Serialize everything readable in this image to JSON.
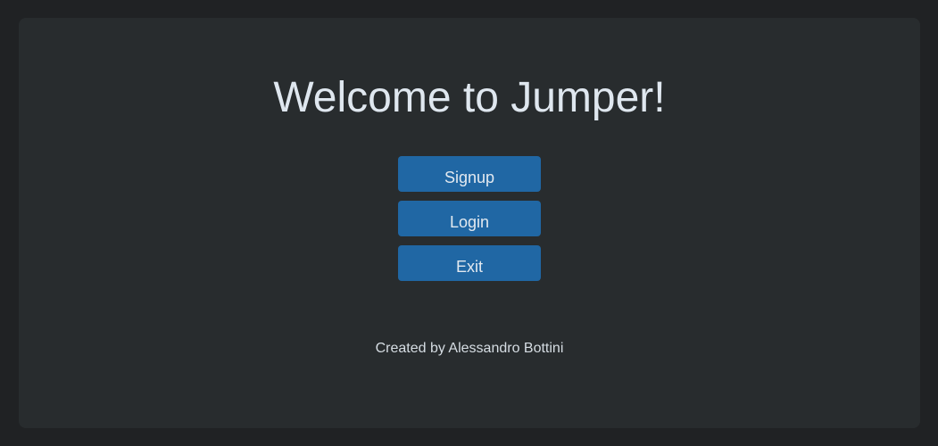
{
  "page": {
    "title": "Welcome to Jumper!",
    "credit": "Created by Alessandro Bottini"
  },
  "menu": {
    "signup_label": "Signup",
    "login_label": "Login",
    "exit_label": "Exit"
  },
  "colors": {
    "background": "#202224",
    "panel": "#282c2e",
    "button": "#2067a4",
    "title_text": "#dfe7ef"
  }
}
